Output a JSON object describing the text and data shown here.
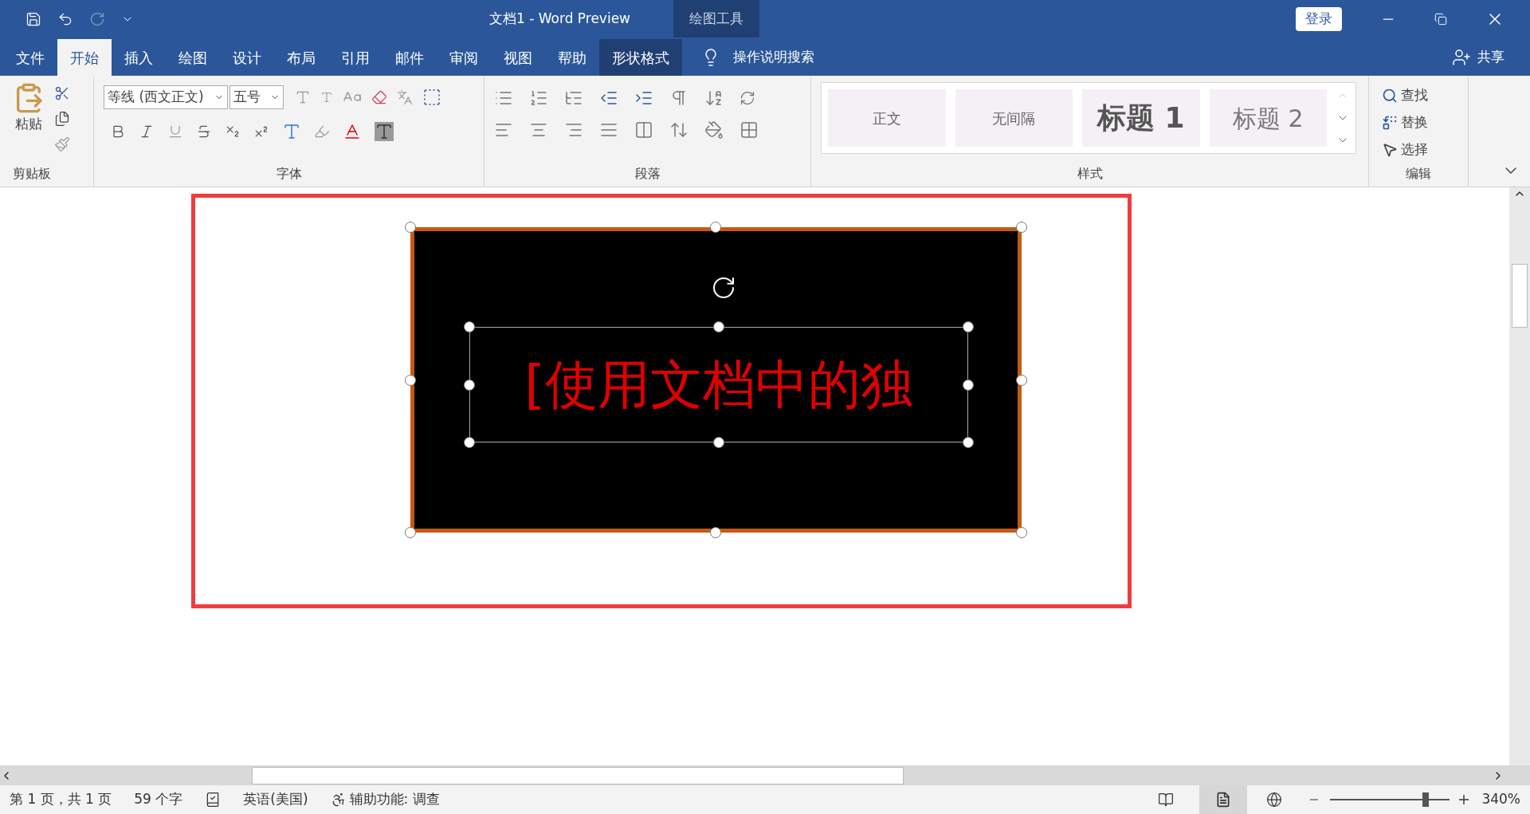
{
  "window": {
    "title": "文档1  -  Word Preview",
    "context_tab": "绘图工具",
    "login": "登录"
  },
  "tabs": [
    {
      "label": "文件",
      "selected": false
    },
    {
      "label": "开始",
      "selected": true
    },
    {
      "label": "插入",
      "selected": false
    },
    {
      "label": "绘图",
      "selected": false
    },
    {
      "label": "设计",
      "selected": false
    },
    {
      "label": "布局",
      "selected": false
    },
    {
      "label": "引用",
      "selected": false
    },
    {
      "label": "邮件",
      "selected": false
    },
    {
      "label": "审阅",
      "selected": false
    },
    {
      "label": "视图",
      "selected": false
    },
    {
      "label": "帮助",
      "selected": false
    },
    {
      "label": "形状格式",
      "selected": false
    }
  ],
  "search": {
    "placeholder": "操作说明搜索"
  },
  "share": "共享",
  "ribbon": {
    "clipboard": {
      "paste": "粘贴",
      "label": "剪贴板"
    },
    "font": {
      "name": "等线 (西文正文)",
      "size": "五号",
      "label": "字体"
    },
    "paragraph": {
      "label": "段落"
    },
    "styles": {
      "items": [
        {
          "name": "正文",
          "kind": "normal"
        },
        {
          "name": "无间隔",
          "kind": "normal"
        },
        {
          "name": "标题 1",
          "kind": "heading1"
        },
        {
          "name": "标题 2",
          "kind": "heading2"
        }
      ],
      "label": "样式"
    },
    "editing": {
      "items": [
        "查找",
        "替换",
        "选择"
      ],
      "label": "编辑"
    }
  },
  "document": {
    "shape_text": "[使用文档中的独"
  },
  "status_bar": {
    "page": "第 1 页，共 1 页",
    "words": "59 个字",
    "language": "英语(美国)",
    "accessibility": "辅助功能: 调查",
    "zoom": "340%",
    "zoom_slider": {
      "level": 0.8
    }
  }
}
